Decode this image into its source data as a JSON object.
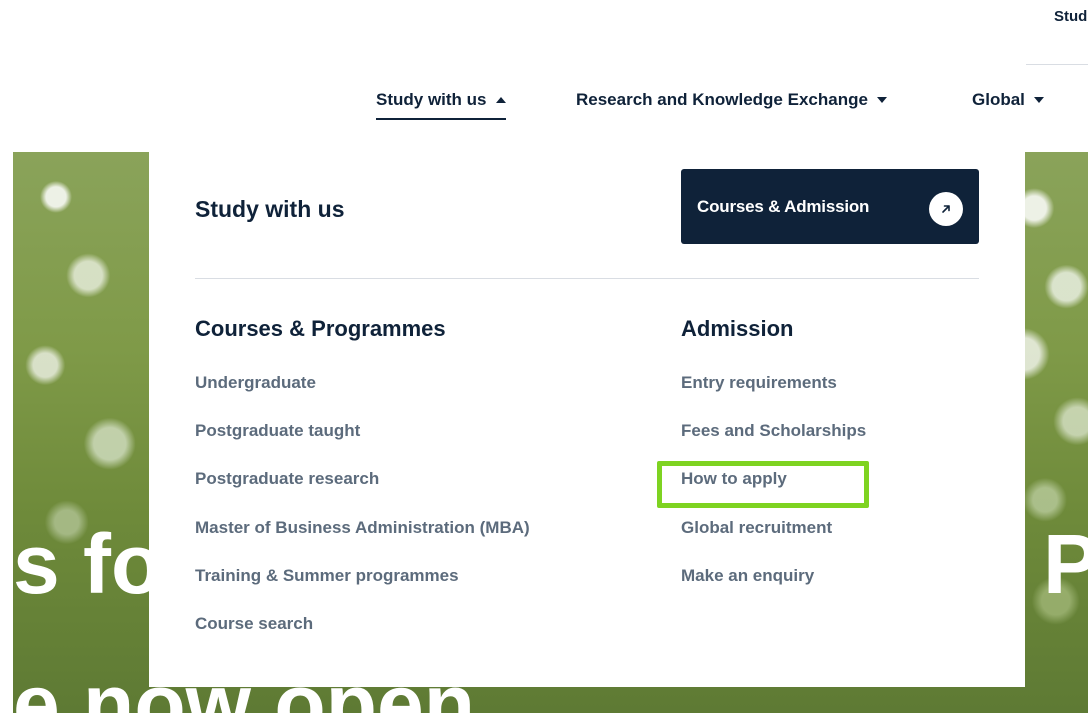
{
  "header": {
    "top_link": "Stud"
  },
  "nav": {
    "items": [
      {
        "label": "Study with us",
        "caret": "up",
        "active": true
      },
      {
        "label": "Research and Knowledge Exchange",
        "caret": "down",
        "active": false
      },
      {
        "label": "Global",
        "caret": "down",
        "active": false
      }
    ]
  },
  "hero": {
    "line1_left": "s fo",
    "line1_right": "P",
    "line2": "e now open"
  },
  "dropdown": {
    "title": "Study with us",
    "cta_label": "Courses & Admission",
    "cta_icon": "arrow-up-right-icon",
    "columns": [
      {
        "heading": "Courses & Programmes",
        "links": [
          "Undergraduate",
          "Postgraduate taught",
          "Postgraduate research",
          "Master of Business Administration (MBA)",
          "Training & Summer programmes",
          "Course search"
        ]
      },
      {
        "heading": "Admission",
        "links": [
          "Entry requirements",
          "Fees and Scholarships",
          "How to apply",
          "Global recruitment",
          "Make an enquiry"
        ]
      }
    ]
  },
  "colors": {
    "navy": "#0f2239",
    "link_gray": "#5c6b7c",
    "highlight": "#7ed321"
  }
}
